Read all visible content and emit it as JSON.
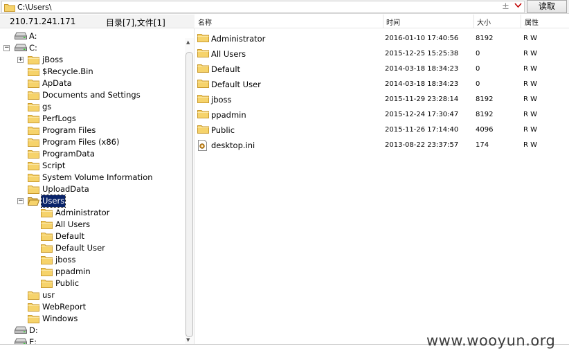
{
  "pathbar": {
    "path": "C:\\Users\\",
    "read_label": "读取",
    "plus": "±"
  },
  "left": {
    "ip": "210.71.241.171",
    "summary": "目录[7],文件[1]",
    "tree": [
      {
        "label": "A:",
        "type": "drive",
        "level": 0
      },
      {
        "label": "C:",
        "type": "drive",
        "level": 0,
        "toggle": "−"
      },
      {
        "label": "jBoss",
        "type": "folder",
        "level": 1,
        "toggle": "+"
      },
      {
        "label": "$Recycle.Bin",
        "type": "folder",
        "level": 1
      },
      {
        "label": "ApData",
        "type": "folder",
        "level": 1
      },
      {
        "label": "Documents and Settings",
        "type": "folder",
        "level": 1
      },
      {
        "label": "gs",
        "type": "folder",
        "level": 1
      },
      {
        "label": "PerfLogs",
        "type": "folder",
        "level": 1
      },
      {
        "label": "Program Files",
        "type": "folder",
        "level": 1
      },
      {
        "label": "Program Files (x86)",
        "type": "folder",
        "level": 1
      },
      {
        "label": "ProgramData",
        "type": "folder",
        "level": 1
      },
      {
        "label": "Script",
        "type": "folder",
        "level": 1
      },
      {
        "label": "System Volume Information",
        "type": "folder",
        "level": 1
      },
      {
        "label": "UploadData",
        "type": "folder",
        "level": 1
      },
      {
        "label": "Users",
        "type": "folder-open",
        "level": 1,
        "toggle": "−",
        "selected": true
      },
      {
        "label": "Administrator",
        "type": "folder",
        "level": 2
      },
      {
        "label": "All Users",
        "type": "folder",
        "level": 2
      },
      {
        "label": "Default",
        "type": "folder",
        "level": 2
      },
      {
        "label": "Default User",
        "type": "folder",
        "level": 2
      },
      {
        "label": "jboss",
        "type": "folder",
        "level": 2
      },
      {
        "label": "ppadmin",
        "type": "folder",
        "level": 2
      },
      {
        "label": "Public",
        "type": "folder",
        "level": 2
      },
      {
        "label": "usr",
        "type": "folder",
        "level": 1
      },
      {
        "label": "WebReport",
        "type": "folder",
        "level": 1
      },
      {
        "label": "Windows",
        "type": "folder",
        "level": 1
      },
      {
        "label": "D:",
        "type": "drive",
        "level": 0
      },
      {
        "label": "E:",
        "type": "drive",
        "level": 0
      }
    ]
  },
  "right": {
    "columns": {
      "name": "名称",
      "time": "时间",
      "size": "大小",
      "attr": "属性"
    },
    "rows": [
      {
        "name": "Administrator",
        "time": "2016-01-10 17:40:56",
        "size": "8192",
        "attr": "R W",
        "type": "folder"
      },
      {
        "name": "All Users",
        "time": "2015-12-25 15:25:38",
        "size": "0",
        "attr": "R W",
        "type": "folder"
      },
      {
        "name": "Default",
        "time": "2014-03-18 18:34:23",
        "size": "0",
        "attr": "R W",
        "type": "folder"
      },
      {
        "name": "Default User",
        "time": "2014-03-18 18:34:23",
        "size": "0",
        "attr": "R W",
        "type": "folder"
      },
      {
        "name": "jboss",
        "time": "2015-11-29 23:28:14",
        "size": "8192",
        "attr": "R W",
        "type": "folder"
      },
      {
        "name": "ppadmin",
        "time": "2015-12-24 17:30:47",
        "size": "8192",
        "attr": "R W",
        "type": "folder"
      },
      {
        "name": "Public",
        "time": "2015-11-26 17:14:40",
        "size": "4096",
        "attr": "R W",
        "type": "folder"
      },
      {
        "name": "desktop.ini",
        "time": "2013-08-22 23:37:57",
        "size": "174",
        "attr": "R W",
        "type": "file"
      }
    ]
  },
  "watermark": "www.wooyun.org",
  "colors": {
    "folder": "#f6d36b",
    "folder_edge": "#c99a2e",
    "selection": "#0a246a"
  }
}
